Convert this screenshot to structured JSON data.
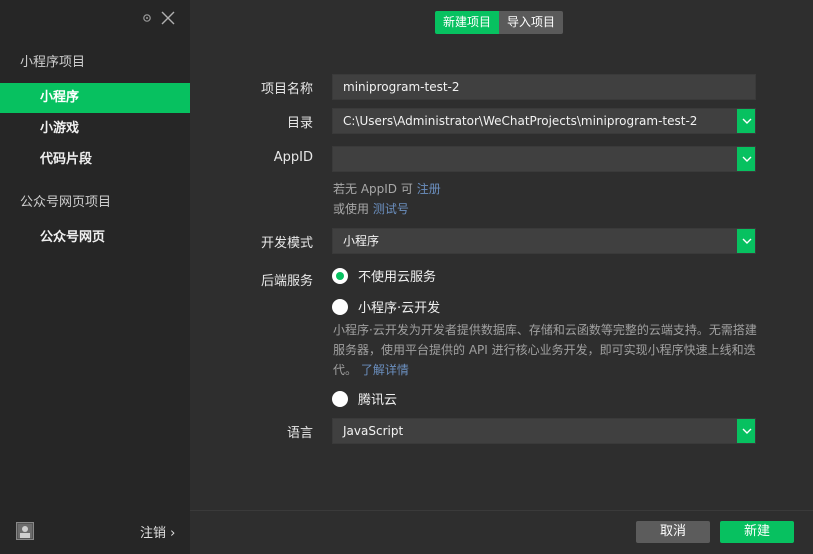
{
  "sidebar": {
    "group_miniprogram": "小程序项目",
    "items_miniprogram": [
      {
        "label": "小程序",
        "active": true
      },
      {
        "label": "小游戏",
        "active": false
      },
      {
        "label": "代码片段",
        "active": false
      }
    ],
    "group_official": "公众号网页项目",
    "items_official": [
      {
        "label": "公众号网页",
        "active": false
      }
    ],
    "logout_label": "注销 ›"
  },
  "tabs": {
    "new_project": "新建项目",
    "import_project": "导入项目"
  },
  "form": {
    "name_label": "项目名称",
    "name_value": "miniprogram-test-2",
    "dir_label": "目录",
    "dir_value": "C:\\Users\\Administrator\\WeChatProjects\\miniprogram-test-2",
    "appid_label": "AppID",
    "appid_value": "",
    "appid_hint_prefix": "若无 AppID 可",
    "appid_hint_register": "注册",
    "appid_hint2_prefix": "或使用",
    "appid_hint2_link": "测试号",
    "mode_label": "开发模式",
    "mode_value": "小程序",
    "backend_label": "后端服务",
    "backend_options": [
      {
        "label": "不使用云服务",
        "checked": true
      },
      {
        "label": "小程序·云开发",
        "checked": false
      },
      {
        "label": "腾讯云",
        "checked": false
      }
    ],
    "cloud_desc": "小程序·云开发为开发者提供数据库、存储和云函数等完整的云端支持。无需搭建服务器，使用平台提供的 API 进行核心业务开发，即可实现小程序快速上线和迭代。",
    "cloud_desc_link": "了解详情",
    "lang_label": "语言",
    "lang_value": "JavaScript"
  },
  "footer": {
    "cancel_label": "取消",
    "create_label": "新建"
  },
  "colors": {
    "accent": "#07c160",
    "sidebar_bg": "#262626",
    "main_bg": "#2e2e2e",
    "field_bg": "#404040",
    "link": "#6b8fbf"
  }
}
